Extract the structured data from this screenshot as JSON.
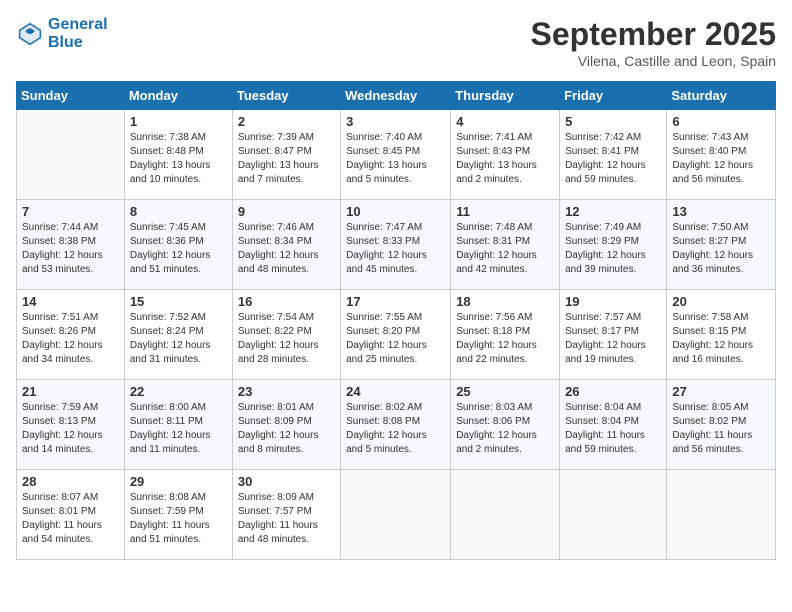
{
  "header": {
    "logo_line1": "General",
    "logo_line2": "Blue",
    "month": "September 2025",
    "location": "Vilena, Castille and Leon, Spain"
  },
  "weekdays": [
    "Sunday",
    "Monday",
    "Tuesday",
    "Wednesday",
    "Thursday",
    "Friday",
    "Saturday"
  ],
  "weeks": [
    [
      {
        "day": "",
        "info": ""
      },
      {
        "day": "1",
        "info": "Sunrise: 7:38 AM\nSunset: 8:48 PM\nDaylight: 13 hours\nand 10 minutes."
      },
      {
        "day": "2",
        "info": "Sunrise: 7:39 AM\nSunset: 8:47 PM\nDaylight: 13 hours\nand 7 minutes."
      },
      {
        "day": "3",
        "info": "Sunrise: 7:40 AM\nSunset: 8:45 PM\nDaylight: 13 hours\nand 5 minutes."
      },
      {
        "day": "4",
        "info": "Sunrise: 7:41 AM\nSunset: 8:43 PM\nDaylight: 13 hours\nand 2 minutes."
      },
      {
        "day": "5",
        "info": "Sunrise: 7:42 AM\nSunset: 8:41 PM\nDaylight: 12 hours\nand 59 minutes."
      },
      {
        "day": "6",
        "info": "Sunrise: 7:43 AM\nSunset: 8:40 PM\nDaylight: 12 hours\nand 56 minutes."
      }
    ],
    [
      {
        "day": "7",
        "info": "Sunrise: 7:44 AM\nSunset: 8:38 PM\nDaylight: 12 hours\nand 53 minutes."
      },
      {
        "day": "8",
        "info": "Sunrise: 7:45 AM\nSunset: 8:36 PM\nDaylight: 12 hours\nand 51 minutes."
      },
      {
        "day": "9",
        "info": "Sunrise: 7:46 AM\nSunset: 8:34 PM\nDaylight: 12 hours\nand 48 minutes."
      },
      {
        "day": "10",
        "info": "Sunrise: 7:47 AM\nSunset: 8:33 PM\nDaylight: 12 hours\nand 45 minutes."
      },
      {
        "day": "11",
        "info": "Sunrise: 7:48 AM\nSunset: 8:31 PM\nDaylight: 12 hours\nand 42 minutes."
      },
      {
        "day": "12",
        "info": "Sunrise: 7:49 AM\nSunset: 8:29 PM\nDaylight: 12 hours\nand 39 minutes."
      },
      {
        "day": "13",
        "info": "Sunrise: 7:50 AM\nSunset: 8:27 PM\nDaylight: 12 hours\nand 36 minutes."
      }
    ],
    [
      {
        "day": "14",
        "info": "Sunrise: 7:51 AM\nSunset: 8:26 PM\nDaylight: 12 hours\nand 34 minutes."
      },
      {
        "day": "15",
        "info": "Sunrise: 7:52 AM\nSunset: 8:24 PM\nDaylight: 12 hours\nand 31 minutes."
      },
      {
        "day": "16",
        "info": "Sunrise: 7:54 AM\nSunset: 8:22 PM\nDaylight: 12 hours\nand 28 minutes."
      },
      {
        "day": "17",
        "info": "Sunrise: 7:55 AM\nSunset: 8:20 PM\nDaylight: 12 hours\nand 25 minutes."
      },
      {
        "day": "18",
        "info": "Sunrise: 7:56 AM\nSunset: 8:18 PM\nDaylight: 12 hours\nand 22 minutes."
      },
      {
        "day": "19",
        "info": "Sunrise: 7:57 AM\nSunset: 8:17 PM\nDaylight: 12 hours\nand 19 minutes."
      },
      {
        "day": "20",
        "info": "Sunrise: 7:58 AM\nSunset: 8:15 PM\nDaylight: 12 hours\nand 16 minutes."
      }
    ],
    [
      {
        "day": "21",
        "info": "Sunrise: 7:59 AM\nSunset: 8:13 PM\nDaylight: 12 hours\nand 14 minutes."
      },
      {
        "day": "22",
        "info": "Sunrise: 8:00 AM\nSunset: 8:11 PM\nDaylight: 12 hours\nand 11 minutes."
      },
      {
        "day": "23",
        "info": "Sunrise: 8:01 AM\nSunset: 8:09 PM\nDaylight: 12 hours\nand 8 minutes."
      },
      {
        "day": "24",
        "info": "Sunrise: 8:02 AM\nSunset: 8:08 PM\nDaylight: 12 hours\nand 5 minutes."
      },
      {
        "day": "25",
        "info": "Sunrise: 8:03 AM\nSunset: 8:06 PM\nDaylight: 12 hours\nand 2 minutes."
      },
      {
        "day": "26",
        "info": "Sunrise: 8:04 AM\nSunset: 8:04 PM\nDaylight: 11 hours\nand 59 minutes."
      },
      {
        "day": "27",
        "info": "Sunrise: 8:05 AM\nSunset: 8:02 PM\nDaylight: 11 hours\nand 56 minutes."
      }
    ],
    [
      {
        "day": "28",
        "info": "Sunrise: 8:07 AM\nSunset: 8:01 PM\nDaylight: 11 hours\nand 54 minutes."
      },
      {
        "day": "29",
        "info": "Sunrise: 8:08 AM\nSunset: 7:59 PM\nDaylight: 11 hours\nand 51 minutes."
      },
      {
        "day": "30",
        "info": "Sunrise: 8:09 AM\nSunset: 7:57 PM\nDaylight: 11 hours\nand 48 minutes."
      },
      {
        "day": "",
        "info": ""
      },
      {
        "day": "",
        "info": ""
      },
      {
        "day": "",
        "info": ""
      },
      {
        "day": "",
        "info": ""
      }
    ]
  ]
}
